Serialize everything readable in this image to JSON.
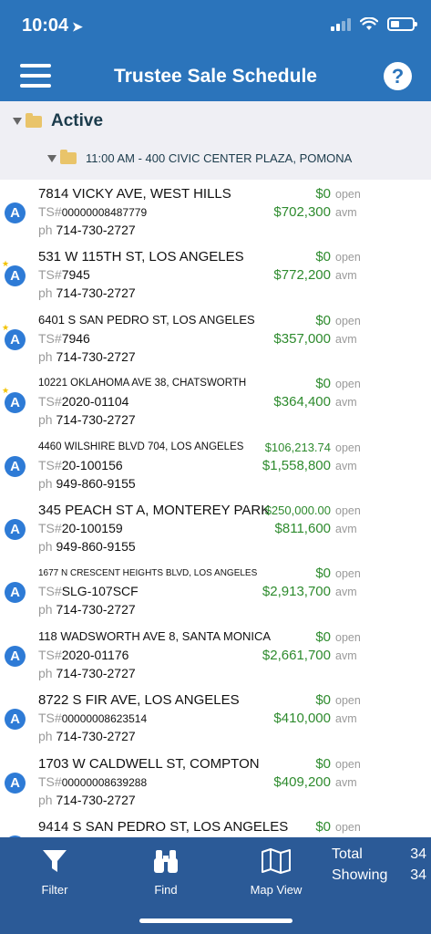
{
  "status_bar": {
    "time": "10:04",
    "location_arrow": "location-arrow-icon"
  },
  "header": {
    "title": "Trustee Sale Schedule",
    "menu_icon": "hamburger-menu-icon",
    "help_label": "?"
  },
  "groups": {
    "active_label": "Active",
    "location_label": "11:00 AM - 400 CIVIC CENTER PLAZA, POMONA"
  },
  "labels": {
    "ts_prefix": "TS#",
    "ph_prefix": "ph",
    "open": "open",
    "avm": "avm"
  },
  "properties": [
    {
      "badge": "A",
      "starred": false,
      "address": "7814 VICKY AVE, WEST HILLS",
      "ts": "00000008487779",
      "phone": "714-730-2727",
      "bid": "$0",
      "avm_value": "$702,300"
    },
    {
      "badge": "A",
      "starred": true,
      "address": "531 W 115TH ST, LOS ANGELES",
      "ts": "7945",
      "phone": "714-730-2727",
      "bid": "$0",
      "avm_value": "$772,200"
    },
    {
      "badge": "A",
      "starred": true,
      "address": "6401 S SAN PEDRO ST, LOS ANGELES",
      "ts": "7946",
      "phone": "714-730-2727",
      "bid": "$0",
      "avm_value": "$357,000"
    },
    {
      "badge": "A",
      "starred": true,
      "address": "10221 OKLAHOMA AVE 38, CHATSWORTH",
      "ts": "2020-01104",
      "phone": "714-730-2727",
      "bid": "$0",
      "avm_value": "$364,400"
    },
    {
      "badge": "A",
      "starred": false,
      "address": "4460 WILSHIRE BLVD 704, LOS ANGELES",
      "ts": "20-100156",
      "phone": "949-860-9155",
      "bid": "$106,213.74",
      "avm_value": "$1,558,800"
    },
    {
      "badge": "A",
      "starred": false,
      "address": "345 PEACH ST A, MONTEREY PARK",
      "ts": "20-100159",
      "phone": "949-860-9155",
      "bid": "$250,000.00",
      "avm_value": "$811,600"
    },
    {
      "badge": "A",
      "starred": false,
      "address": "1677 N CRESCENT HEIGHTS BLVD, LOS ANGELES",
      "ts": "SLG-107SCF",
      "phone": "714-730-2727",
      "bid": "$0",
      "avm_value": "$2,913,700"
    },
    {
      "badge": "A",
      "starred": false,
      "address": "118 WADSWORTH AVE 8, SANTA MONICA",
      "ts": "2020-01176",
      "phone": "714-730-2727",
      "bid": "$0",
      "avm_value": "$2,661,700"
    },
    {
      "badge": "A",
      "starred": false,
      "address": "8722 S FIR AVE, LOS ANGELES",
      "ts": "00000008623514",
      "phone": "714-730-2727",
      "bid": "$0",
      "avm_value": "$410,000"
    },
    {
      "badge": "A",
      "starred": false,
      "address": "1703 W CALDWELL ST, COMPTON",
      "ts": "00000008639288",
      "phone": "714-730-2727",
      "bid": "$0",
      "avm_value": "$409,200"
    },
    {
      "badge": "A",
      "starred": false,
      "address": "9414 S SAN PEDRO ST, LOS ANGELES",
      "ts": "",
      "phone": "",
      "bid": "$0",
      "avm_value": ""
    }
  ],
  "toolbar": {
    "filter_label": "Filter",
    "find_label": "Find",
    "map_label": "Map View",
    "total_label": "Total",
    "total_value": "34",
    "showing_label": "Showing",
    "showing_value": "34"
  },
  "colors": {
    "header_bg": "#2b74bb",
    "toolbar_bg": "#2b5a97",
    "money_green": "#2e8b2e",
    "badge_blue": "#2e7bd6"
  }
}
